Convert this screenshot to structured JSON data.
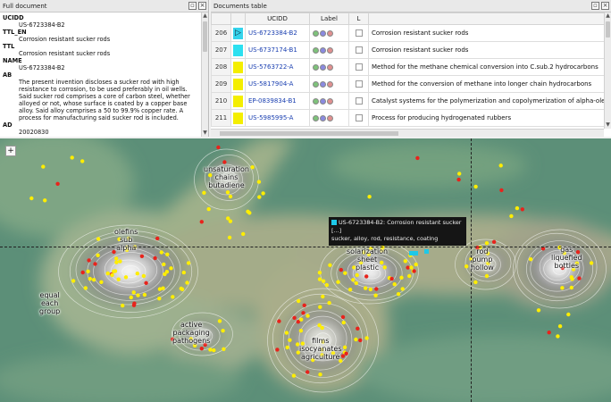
{
  "left_panel": {
    "title": "Full document",
    "fields": [
      {
        "key": "UCIDD",
        "value": "US-6723384-B2"
      },
      {
        "key": "TTL_EN",
        "value": "Corrosion resistant sucker rods"
      },
      {
        "key": "TTL",
        "value": "Corrosion resistant sucker rods"
      },
      {
        "key": "NAME",
        "value": "US-6723384-B2"
      },
      {
        "key": "AB",
        "value": "The present invention discloses a sucker rod with high resistance to corrosion, to be used preferably in oil wells. Said sucker rod comprises a core of carbon steel, whether alloyed or not, whose surface is coated by a copper base alloy. Said alloy comprises a 50 to 99.9% copper rate. A process for manufacturing said sucker rod is included."
      },
      {
        "key": "AD",
        "value": "20020830"
      }
    ]
  },
  "right_panel": {
    "title": "Documents table",
    "columns": [
      "",
      "",
      "UCIDD",
      "Label",
      "L",
      ""
    ],
    "rows": [
      {
        "num": "206",
        "color": "#35d4ec",
        "marker": "▷",
        "id": "US-6723384-B2",
        "title": "Corrosion resistant sucker rods"
      },
      {
        "num": "207",
        "color": "#2ce0f0",
        "marker": "",
        "id": "US-6737174-B1",
        "title": "Corrosion resistant sucker rods"
      },
      {
        "num": "208",
        "color": "#f4ee00",
        "marker": "",
        "id": "US-5763722-A",
        "title": "Method for the methane chemical conversion into C.sub.2 hydrocarbons"
      },
      {
        "num": "209",
        "color": "#f4ee00",
        "marker": "",
        "id": "US-5817904-A",
        "title": "Method for the conversion of methane into longer chain hydrocarbons"
      },
      {
        "num": "210",
        "color": "#f4ee00",
        "marker": "",
        "id": "EP-0839834-B1",
        "title": "Catalyst systems for the polymerization and copolymerization of alpha-olefins"
      },
      {
        "num": "211",
        "color": "#f4ee00",
        "marker": "",
        "id": "US-5985995-A",
        "title": "Process for producing hydrogenated rubbers"
      }
    ],
    "label_colors": [
      "#7ec27a",
      "#8a8ae0",
      "#e09090"
    ]
  },
  "map": {
    "cluster_labels": [
      {
        "text": "unsaturation\nchains\nbutadiene"
      },
      {
        "text": "olefins\nsub\nalpha"
      },
      {
        "text": "equal\neach\ngroup"
      },
      {
        "text": "active\npackaging\npathogens"
      },
      {
        "text": "films\nisocyanates\nagriculture"
      },
      {
        "text": "solarization\nsheet\nplastic"
      },
      {
        "text": "rod\npump\nhollow"
      },
      {
        "text": "gas\nliquefied\nbottles"
      }
    ],
    "tooltip": {
      "title": "US-6723384-B2: Corrosion resistant sucker [...]",
      "keywords": "sucker, alloy, rod, resistance, coating"
    },
    "zoom_label": "+"
  }
}
